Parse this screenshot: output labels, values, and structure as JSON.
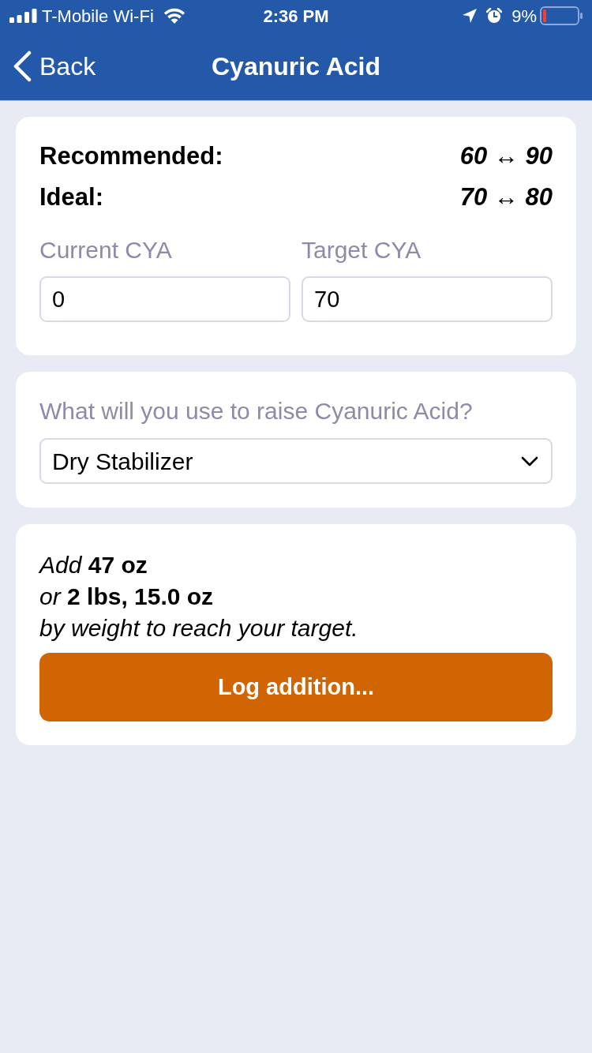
{
  "status_bar": {
    "carrier": "T-Mobile Wi-Fi",
    "time": "2:36 PM",
    "battery": "9%"
  },
  "nav": {
    "back": "Back",
    "title": "Cyanuric Acid"
  },
  "ranges": [
    {
      "label": "Recommended:",
      "value": "60 ↔ 90"
    },
    {
      "label": "Ideal:",
      "value": "70 ↔ 80"
    }
  ],
  "fields": [
    {
      "label": "Current CYA",
      "value": "0"
    },
    {
      "label": "Target CYA",
      "value": "70"
    }
  ],
  "source": {
    "label": "What will you use to raise Cyanuric Acid?",
    "value": "Dry Stabilizer"
  },
  "result": {
    "lines": [
      "*Add* **47 oz**",
      "*or* **2 lbs, 15.0 oz**",
      "*by weight to reach your target.*"
    ],
    "button": "Log addition..."
  }
}
